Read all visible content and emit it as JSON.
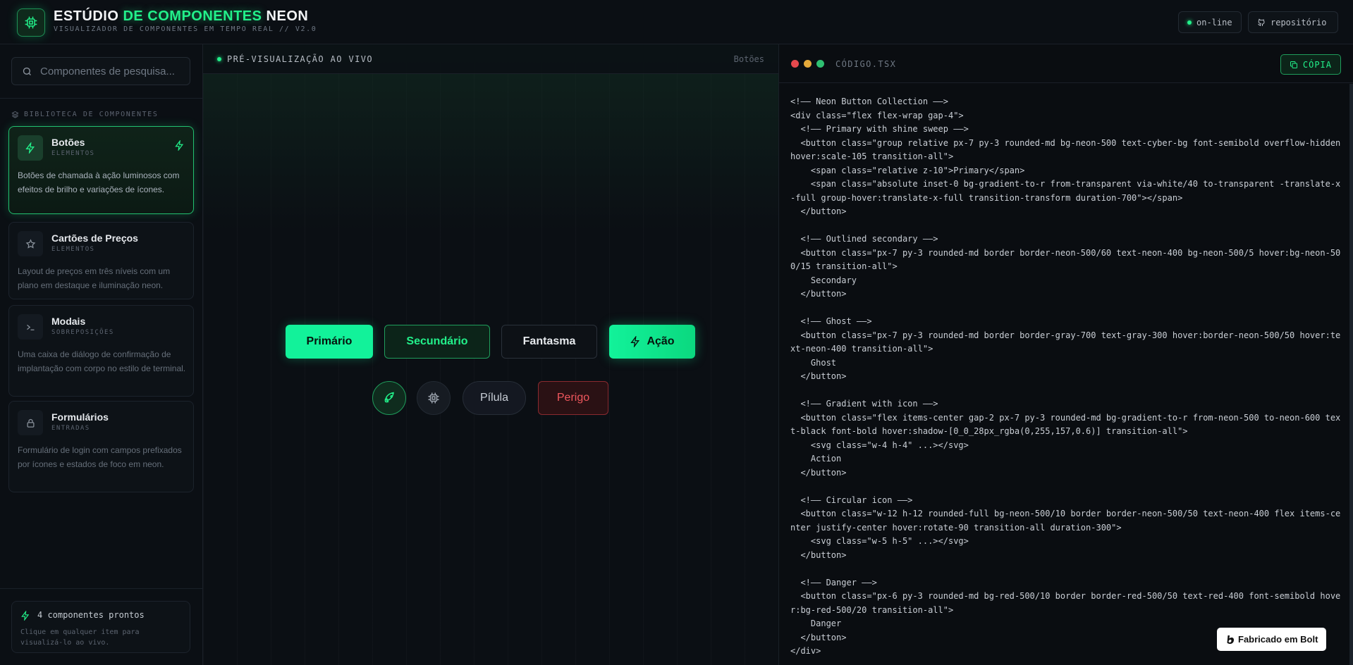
{
  "header": {
    "title_part1": "ESTÚDIO ",
    "title_accent": "DE COMPONENTES",
    "title_part2": " NEON",
    "subtitle": "VISUALIZADOR DE COMPONENTES EM TEMPO REAL // V2.0",
    "status_label": "on-line",
    "repo_label": "repositório"
  },
  "sidebar": {
    "search_placeholder": "Componentes de pesquisa...",
    "library_label": "BIBLIOTECA DE COMPONENTES",
    "items": [
      {
        "title": "Botões",
        "category": "ELEMENTOS",
        "description": "Botões de chamada à ação luminosos com efeitos de brilho e variações de ícones.",
        "icon": "bolt-icon",
        "active": true
      },
      {
        "title": "Cartões de Preços",
        "category": "ELEMENTOS",
        "description": "Layout de preços em três níveis com um plano em destaque e iluminação neon.",
        "icon": "star-icon",
        "active": false
      },
      {
        "title": "Modais",
        "category": "SOBREPOSIÇÕES",
        "description": "Uma caixa de diálogo de confirmação de implantação com corpo no estilo de terminal.",
        "icon": "terminal-icon",
        "active": false
      },
      {
        "title": "Formulários",
        "category": "ENTRADAS",
        "description": "Formulário de login com campos prefixados por ícones e estados de foco em neon.",
        "icon": "lock-icon",
        "active": false
      }
    ],
    "ready_title": "4 componentes prontos",
    "ready_sub": "Clique em qualquer item para visualizá-lo ao vivo."
  },
  "preview": {
    "label": "PRÉ-VISUALIZAÇÃO AO VIVO",
    "crumb": "Botões",
    "buttons": {
      "primary": "Primário",
      "secondary": "Secundário",
      "ghost": "Fantasma",
      "action": "Ação",
      "pill": "Pílula",
      "danger": "Perigo"
    }
  },
  "code_panel": {
    "file_name": "CÓDIGO.TSX",
    "copy_label": "CÓPIA",
    "code": "<!—— Neon Button Collection ——>\n<div class=\"flex flex-wrap gap-4\">\n  <!—— Primary with shine sweep ——>\n  <button class=\"group relative px-7 py-3 rounded-md bg-neon-500 text-cyber-bg font-semibold overflow-hidden hover:scale-105 transition-all\">\n    <span class=\"relative z-10\">Primary</span>\n    <span class=\"absolute inset-0 bg-gradient-to-r from-transparent via-white/40 to-transparent -translate-x-full group-hover:translate-x-full transition-transform duration-700\"></span>\n  </button>\n\n  <!—— Outlined secondary ——>\n  <button class=\"px-7 py-3 rounded-md border border-neon-500/60 text-neon-400 bg-neon-500/5 hover:bg-neon-500/15 transition-all\">\n    Secondary\n  </button>\n\n  <!—— Ghost ——>\n  <button class=\"px-7 py-3 rounded-md border border-gray-700 text-gray-300 hover:border-neon-500/50 hover:text-neon-400 transition-all\">\n    Ghost\n  </button>\n\n  <!—— Gradient with icon ——>\n  <button class=\"flex items-center gap-2 px-7 py-3 rounded-md bg-gradient-to-r from-neon-500 to-neon-600 text-black font-bold hover:shadow-[0_0_28px_rgba(0,255,157,0.6)] transition-all\">\n    <svg class=\"w-4 h-4\" ...></svg>\n    Action\n  </button>\n\n  <!—— Circular icon ——>\n  <button class=\"w-12 h-12 rounded-full bg-neon-500/10 border border-neon-500/50 text-neon-400 flex items-center justify-center hover:rotate-90 transition-all duration-300\">\n    <svg class=\"w-5 h-5\" ...></svg>\n  </button>\n\n  <!—— Danger ——>\n  <button class=\"px-6 py-3 rounded-md bg-red-500/10 border border-red-500/50 text-red-400 font-semibold hover:bg-red-500/20 transition-all\">\n    Danger\n  </button>\n</div>"
  },
  "badge": {
    "label": "Fabricado em Bolt"
  },
  "colors": {
    "accent": "#22f08a",
    "danger": "#f0575d",
    "background": "#0a0d12"
  }
}
